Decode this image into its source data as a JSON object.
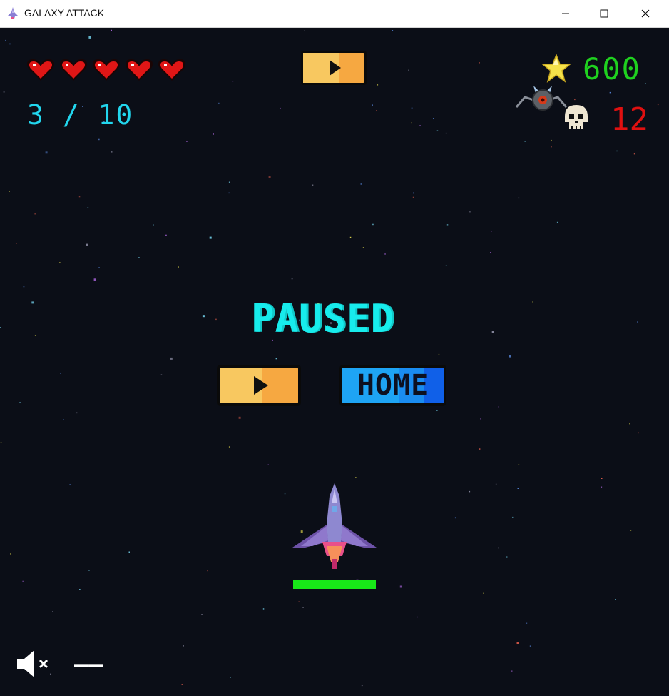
{
  "window": {
    "title": "GALAXY ATTACK",
    "controls": [
      "minimize",
      "maximize",
      "close"
    ]
  },
  "hud": {
    "lives": 5,
    "wave": "3 / 10",
    "score": "600",
    "kills": "12",
    "health_fraction": 1.0
  },
  "pause_menu": {
    "title": "PAUSED",
    "resume_icon": "play-icon",
    "home_label": "HOME"
  },
  "sound": {
    "icon": "speaker-muted-icon",
    "volume_text": "––"
  },
  "colors": {
    "background": "#0b0e17",
    "wave": "#22d6ee",
    "score": "#1fd11f",
    "kills": "#e01010",
    "paused": "#17ecec",
    "resume_button": "#f6a841",
    "home_button": "#1a8cf0",
    "health": "#18e818"
  }
}
